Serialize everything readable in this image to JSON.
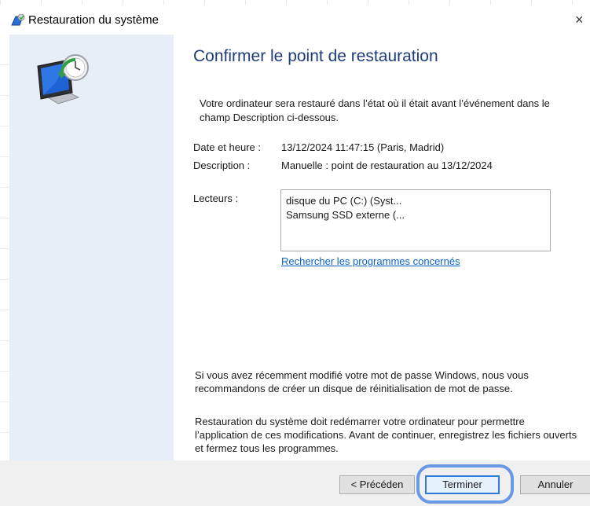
{
  "window": {
    "title": "Restauration du système",
    "close_glyph": "×"
  },
  "page": {
    "title": "Confirmer le point de restauration",
    "intro": "Votre ordinateur sera restauré dans l’état où il était avant l’événement dans le champ Description ci-dessous."
  },
  "fields": {
    "date_label": "Date et heure :",
    "date_value": "13/12/2024 11:47:15 (Paris, Madrid)",
    "description_label": "Description :",
    "description_value": "Manuelle : point de restauration au 13/12/2024",
    "drives_label": "Lecteurs :",
    "drives": [
      "disque du PC (C:) (Syst...",
      "Samsung SSD externe (..."
    ]
  },
  "link": {
    "affected_programs": "Rechercher les programmes concernés"
  },
  "notes": {
    "password": "Si vous avez récemment modifié votre mot de passe Windows, nous vous recommandons de créer un disque de réinitialisation de mot de passe.",
    "restart": "Restauration du système doit redémarrer votre ordinateur pour permettre l’application de ces modifications. Avant de continuer, enregistrez les fichiers ouverts et fermez tous les programmes."
  },
  "buttons": {
    "previous": "< Précéden",
    "finish": "Terminer",
    "cancel": "Annuler"
  },
  "icons": {
    "title_icon": "system-restore-icon",
    "side_image": "system-restore-computer-icon",
    "close": "close-icon"
  },
  "colors": {
    "title_blue": "#1f3d7a",
    "link_blue": "#0b62c4",
    "side_panel": "#e7eef8",
    "footer": "#f0f0f0",
    "highlight": "#5a8fe0"
  }
}
